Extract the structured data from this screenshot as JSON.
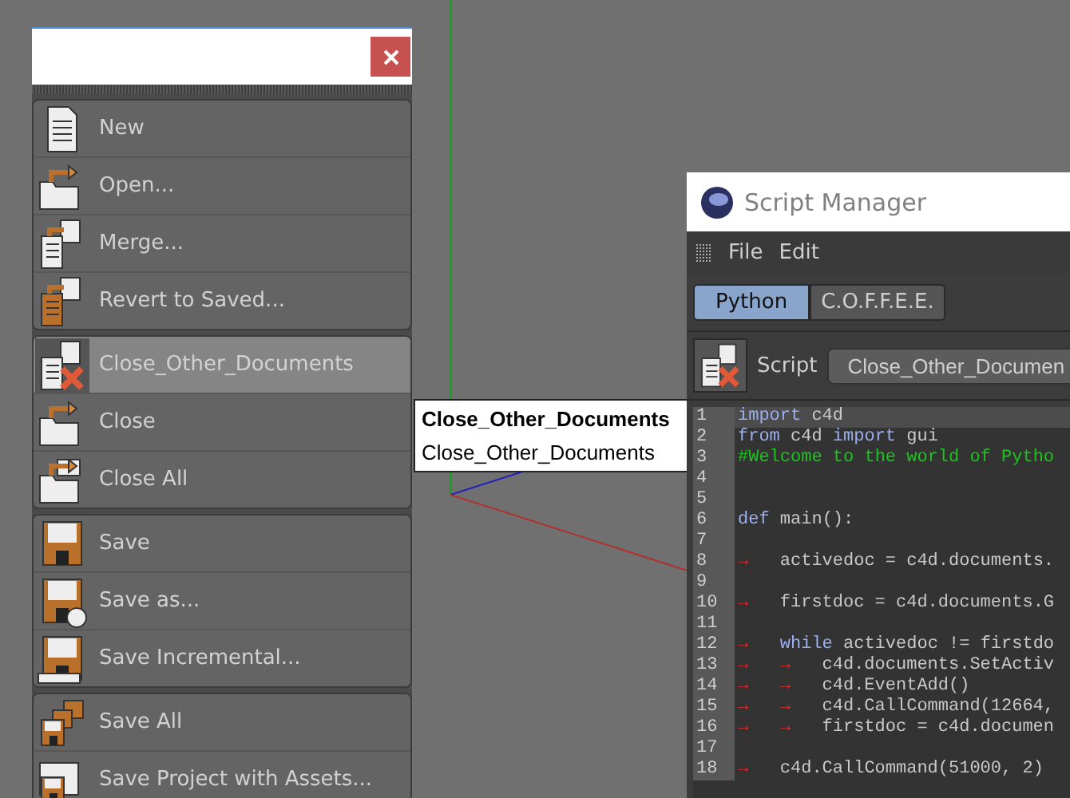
{
  "file_menu": {
    "groups": [
      {
        "items": [
          {
            "label": "New",
            "selected": false
          },
          {
            "label": "Open...",
            "selected": false
          },
          {
            "label": "Merge...",
            "selected": false
          },
          {
            "label": "Revert to Saved...",
            "selected": false
          }
        ]
      },
      {
        "items": [
          {
            "label": "Close_Other_Documents",
            "selected": true
          },
          {
            "label": "Close",
            "selected": false
          },
          {
            "label": "Close All",
            "selected": false
          }
        ]
      },
      {
        "items": [
          {
            "label": "Save",
            "selected": false
          },
          {
            "label": "Save as...",
            "selected": false
          },
          {
            "label": "Save Incremental...",
            "selected": false
          }
        ]
      },
      {
        "items": [
          {
            "label": "Save All",
            "selected": false
          },
          {
            "label": "Save Project with Assets...",
            "selected": false
          }
        ]
      }
    ]
  },
  "tooltip": {
    "title": "Close_Other_Documents",
    "text": "Close_Other_Documents"
  },
  "script_manager": {
    "title": "Script Manager",
    "menu": [
      "File",
      "Edit"
    ],
    "tabs": [
      {
        "label": "Python",
        "selected": true
      },
      {
        "label": "C.O.F.F.E.E.",
        "selected": false
      }
    ],
    "script_label": "Script",
    "script_value": "Close_Other_Documen",
    "code_lines": [
      {
        "number": "1",
        "selected": true,
        "segments": [
          {
            "kind": "keyword",
            "text": "import"
          },
          {
            "kind": "plain",
            "text": " c4d"
          }
        ]
      },
      {
        "number": "2",
        "selected": false,
        "segments": [
          {
            "kind": "keyword",
            "text": "from"
          },
          {
            "kind": "plain",
            "text": " c4d "
          },
          {
            "kind": "keyword",
            "text": "import"
          },
          {
            "kind": "plain",
            "text": " gui"
          }
        ]
      },
      {
        "number": "3",
        "selected": false,
        "segments": [
          {
            "kind": "comment",
            "text": "#Welcome to the world of Pytho"
          }
        ]
      },
      {
        "number": "4",
        "selected": false
      },
      {
        "number": "5",
        "selected": false
      },
      {
        "number": "6",
        "selected": false,
        "segments": [
          {
            "kind": "keyword",
            "text": "def"
          },
          {
            "kind": "plain",
            "text": " main():"
          }
        ]
      },
      {
        "number": "7",
        "selected": false
      },
      {
        "number": "8",
        "selected": false,
        "segments": [
          {
            "kind": "tab",
            "text": "→"
          },
          {
            "kind": "plain",
            "text": "activedoc = c4d.documents."
          }
        ]
      },
      {
        "number": "9",
        "selected": false
      },
      {
        "number": "10",
        "selected": false,
        "segments": [
          {
            "kind": "tab",
            "text": "→"
          },
          {
            "kind": "plain",
            "text": "firstdoc = c4d.documents.G"
          }
        ]
      },
      {
        "number": "11",
        "selected": false
      },
      {
        "number": "12",
        "selected": false,
        "segments": [
          {
            "kind": "tab",
            "text": "→"
          },
          {
            "kind": "keyword",
            "text": "while"
          },
          {
            "kind": "plain",
            "text": " activedoc != firstdo"
          }
        ]
      },
      {
        "number": "13",
        "selected": false,
        "segments": [
          {
            "kind": "tab",
            "text": "→"
          },
          {
            "kind": "tab",
            "text": "→"
          },
          {
            "kind": "plain",
            "text": "c4d.documents.SetActiv"
          }
        ]
      },
      {
        "number": "14",
        "selected": false,
        "segments": [
          {
            "kind": "tab",
            "text": "→"
          },
          {
            "kind": "tab",
            "text": "→"
          },
          {
            "kind": "plain",
            "text": "c4d.EventAdd()"
          }
        ]
      },
      {
        "number": "15",
        "selected": false,
        "segments": [
          {
            "kind": "tab",
            "text": "→"
          },
          {
            "kind": "tab",
            "text": "→"
          },
          {
            "kind": "plain",
            "text": "c4d.CallCommand(12664,"
          }
        ]
      },
      {
        "number": "16",
        "selected": false,
        "segments": [
          {
            "kind": "tab",
            "text": "→"
          },
          {
            "kind": "tab",
            "text": "→"
          },
          {
            "kind": "plain",
            "text": "firstdoc = c4d.documen"
          }
        ]
      },
      {
        "number": "17",
        "selected": false
      },
      {
        "number": "18",
        "selected": false,
        "segments": [
          {
            "kind": "tab",
            "text": "→"
          },
          {
            "kind": "plain",
            "text": "c4d.CallCommand(51000, 2)"
          }
        ]
      }
    ]
  }
}
